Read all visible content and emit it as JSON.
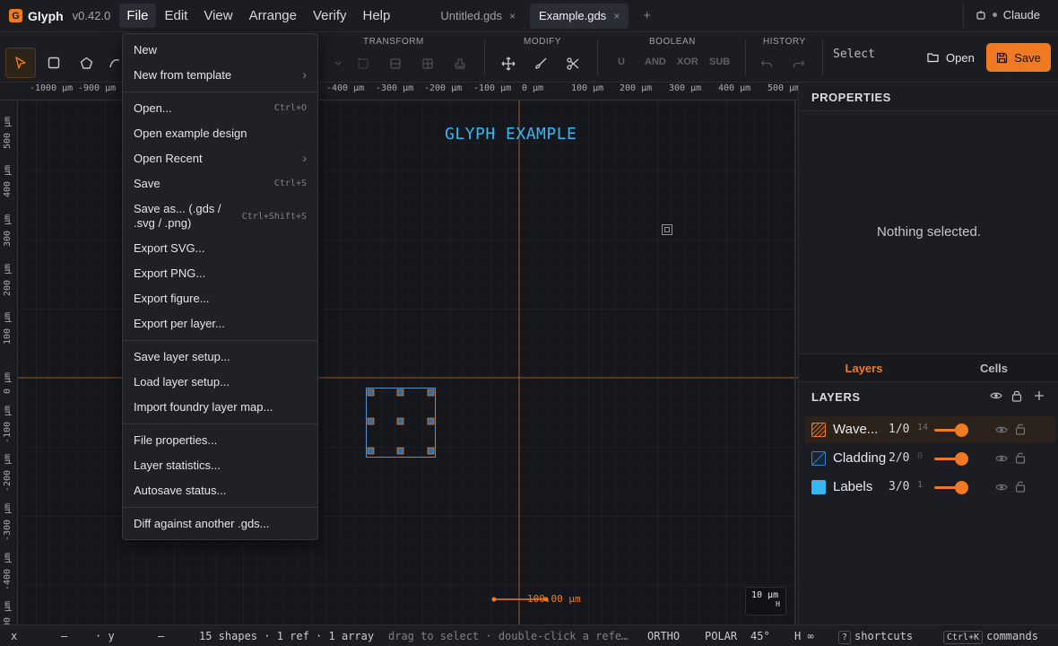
{
  "app": {
    "name": "Glyph",
    "version": "v0.42.0"
  },
  "menus": [
    "File",
    "Edit",
    "View",
    "Arrange",
    "Verify",
    "Help"
  ],
  "tabs": [
    {
      "label": "Untitled.gds",
      "close": "×"
    },
    {
      "label": "Example.gds",
      "close": "×"
    }
  ],
  "new_tab": "+",
  "user": {
    "name": "Claude"
  },
  "toolbar": {
    "groups": [
      "TRANSFORM",
      "MODIFY",
      "BOOLEAN",
      "HISTORY"
    ],
    "boolean_ops": [
      "U",
      "AND",
      "XOR",
      "SUB"
    ],
    "mode": "Select",
    "open_label": "Open",
    "save_label": "Save"
  },
  "ruler_x": [
    "-1000 µm",
    "-900 µm",
    "-400 µm",
    "-300 µm",
    "-200 µm",
    "-100 µm",
    "0 µm",
    "100 µm",
    "200 µm",
    "300 µm",
    "400 µm",
    "500 µm"
  ],
  "ruler_y": [
    "500 µm",
    "400 µm",
    "300 µm",
    "200 µm",
    "100 µm",
    "0 µm",
    "-100 µm",
    "-200 µm",
    "-300 µm",
    "-400 µm",
    "-500 µm"
  ],
  "canvas": {
    "title_text": "GLYPH EXAMPLE",
    "scale_bar": "100.00 µm",
    "scale_indicator": "10 µm",
    "scale_indicator_sub": "H"
  },
  "file_menu": {
    "items": [
      {
        "label": "New",
        "shortcut": ""
      },
      {
        "label": "New from template",
        "shortcut": "",
        "submenu": "›"
      },
      {
        "label": "Open...",
        "shortcut": "Ctrl+O"
      },
      {
        "label": "Open example design",
        "shortcut": ""
      },
      {
        "label": "Open Recent",
        "shortcut": "",
        "submenu": "›"
      },
      {
        "label": "Save",
        "shortcut": "Ctrl+S"
      },
      {
        "label": "Save as... (.gds / .svg / .png)",
        "shortcut": "Ctrl+Shift+S"
      },
      {
        "label": "Export SVG...",
        "shortcut": ""
      },
      {
        "label": "Export PNG...",
        "shortcut": ""
      },
      {
        "label": "Export figure...",
        "shortcut": ""
      },
      {
        "label": "Export per layer...",
        "shortcut": ""
      },
      {
        "label": "Save layer setup...",
        "shortcut": ""
      },
      {
        "label": "Load layer setup...",
        "shortcut": ""
      },
      {
        "label": "Import foundry layer map...",
        "shortcut": ""
      },
      {
        "label": "File properties...",
        "shortcut": ""
      },
      {
        "label": "Layer statistics...",
        "shortcut": ""
      },
      {
        "label": "Autosave status...",
        "shortcut": ""
      },
      {
        "label": "Diff against another .gds...",
        "shortcut": ""
      }
    ]
  },
  "properties": {
    "title": "PROPERTIES",
    "empty": "Nothing selected."
  },
  "panel_tabs": [
    "Layers",
    "Cells"
  ],
  "layers": {
    "title": "LAYERS",
    "items": [
      {
        "name": "Wave...",
        "number": "1/0",
        "count": "14",
        "color": "#f07a22",
        "opacity": 1.0
      },
      {
        "name": "Cladding",
        "number": "2/0",
        "count": "0",
        "color": "#3b82c4",
        "opacity": 1.0
      },
      {
        "name": "Labels",
        "number": "3/0",
        "count": "1",
        "color": "#38b6f0",
        "opacity": 1.0
      }
    ]
  },
  "status": {
    "x_label": "x",
    "x_val": "—",
    "y_label": "· y",
    "y_val": "—",
    "counts": "15 shapes · 1 ref · 1 array",
    "hint": "drag to select · double-click a refe…",
    "ortho": "ORTHO",
    "polar": "POLAR",
    "angle": "45°",
    "h": "H ∞",
    "shortcuts_key": "?",
    "shortcuts": "shortcuts",
    "commands_key": "Ctrl+K",
    "commands": "commands"
  },
  "colors": {
    "accent": "#f07a22",
    "background": "#16181d",
    "panel": "#1b1d22",
    "label_blue": "#38b6f0"
  }
}
